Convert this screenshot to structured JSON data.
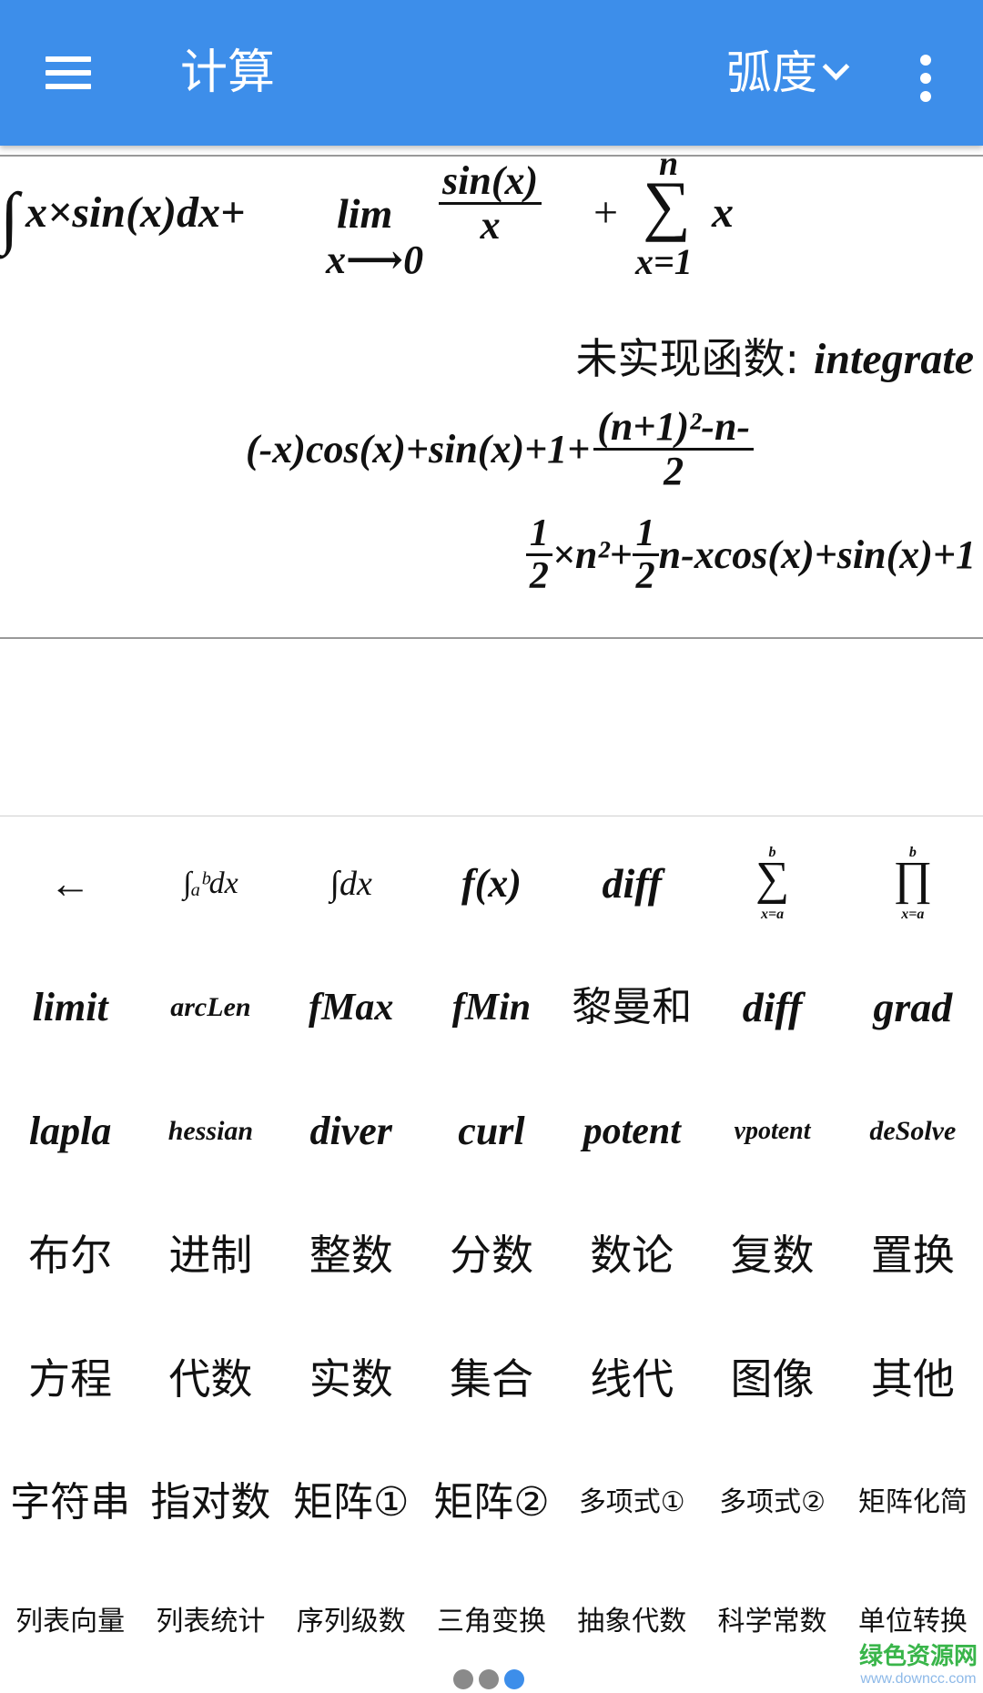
{
  "app": {
    "title": "计算",
    "angle_mode": "弧度",
    "accent_color": "#3d8eea"
  },
  "icons": {
    "menu": "hamburger-menu-icon",
    "dropdown": "chevron-down-icon",
    "more": "vertical-dots-icon"
  },
  "output": {
    "line1": {
      "integral_sign": "∫",
      "integrand": "x×sin(x)dx+",
      "lim_word": "lim",
      "lim_sub": "x⟶0",
      "frac_num": "sin(x)",
      "frac_den": "x",
      "plus": "+",
      "sum_sign": "∑",
      "sum_top": "n",
      "sum_bottom": "x=1",
      "sum_body": "x"
    },
    "line2": {
      "label": "未实现函数:",
      "func": "integrate"
    },
    "line3": {
      "main": "(-x)cos(x)+sin(x)+1+",
      "frac_num": "(n+1)²-n-",
      "frac_den": "2"
    },
    "line4": {
      "frac1_num": "1",
      "frac1_den": "2",
      "mid": "×n²+",
      "frac2_num": "1",
      "frac2_den": "2",
      "tail": "n-xcos(x)+sin(x)+1"
    }
  },
  "keypad": {
    "row1": [
      "←",
      "∫ₐᵇdx",
      "∫dx",
      "f(x)",
      "diff",
      "∑",
      "∏"
    ],
    "row1_limits": {
      "sum_top": "b",
      "sum_bottom": "x=a",
      "prod_top": "b",
      "prod_bottom": "x=a"
    },
    "row2": [
      "limit",
      "arcLen",
      "fMax",
      "fMin",
      "黎曼和",
      "diff",
      "grad"
    ],
    "row3": [
      "lapla",
      "hessian",
      "diver",
      "curl",
      "potent",
      "vpotent",
      "deSolve"
    ],
    "row4": [
      "布尔",
      "进制",
      "整数",
      "分数",
      "数论",
      "复数",
      "置换"
    ],
    "row5": [
      "方程",
      "代数",
      "实数",
      "集合",
      "线代",
      "图像",
      "其他"
    ],
    "row6": [
      "字符串",
      "指对数",
      "矩阵①",
      "矩阵②",
      "多项式①",
      "多项式②",
      "矩阵化简"
    ],
    "row7": [
      "列表向量",
      "列表统计",
      "序列级数",
      "三角变换",
      "抽象代数",
      "科学常数",
      "单位转换"
    ]
  },
  "pager": {
    "pages": 3,
    "active": 3
  },
  "watermark": {
    "line1": "绿色资源网",
    "line2": "www.downcc.com"
  }
}
